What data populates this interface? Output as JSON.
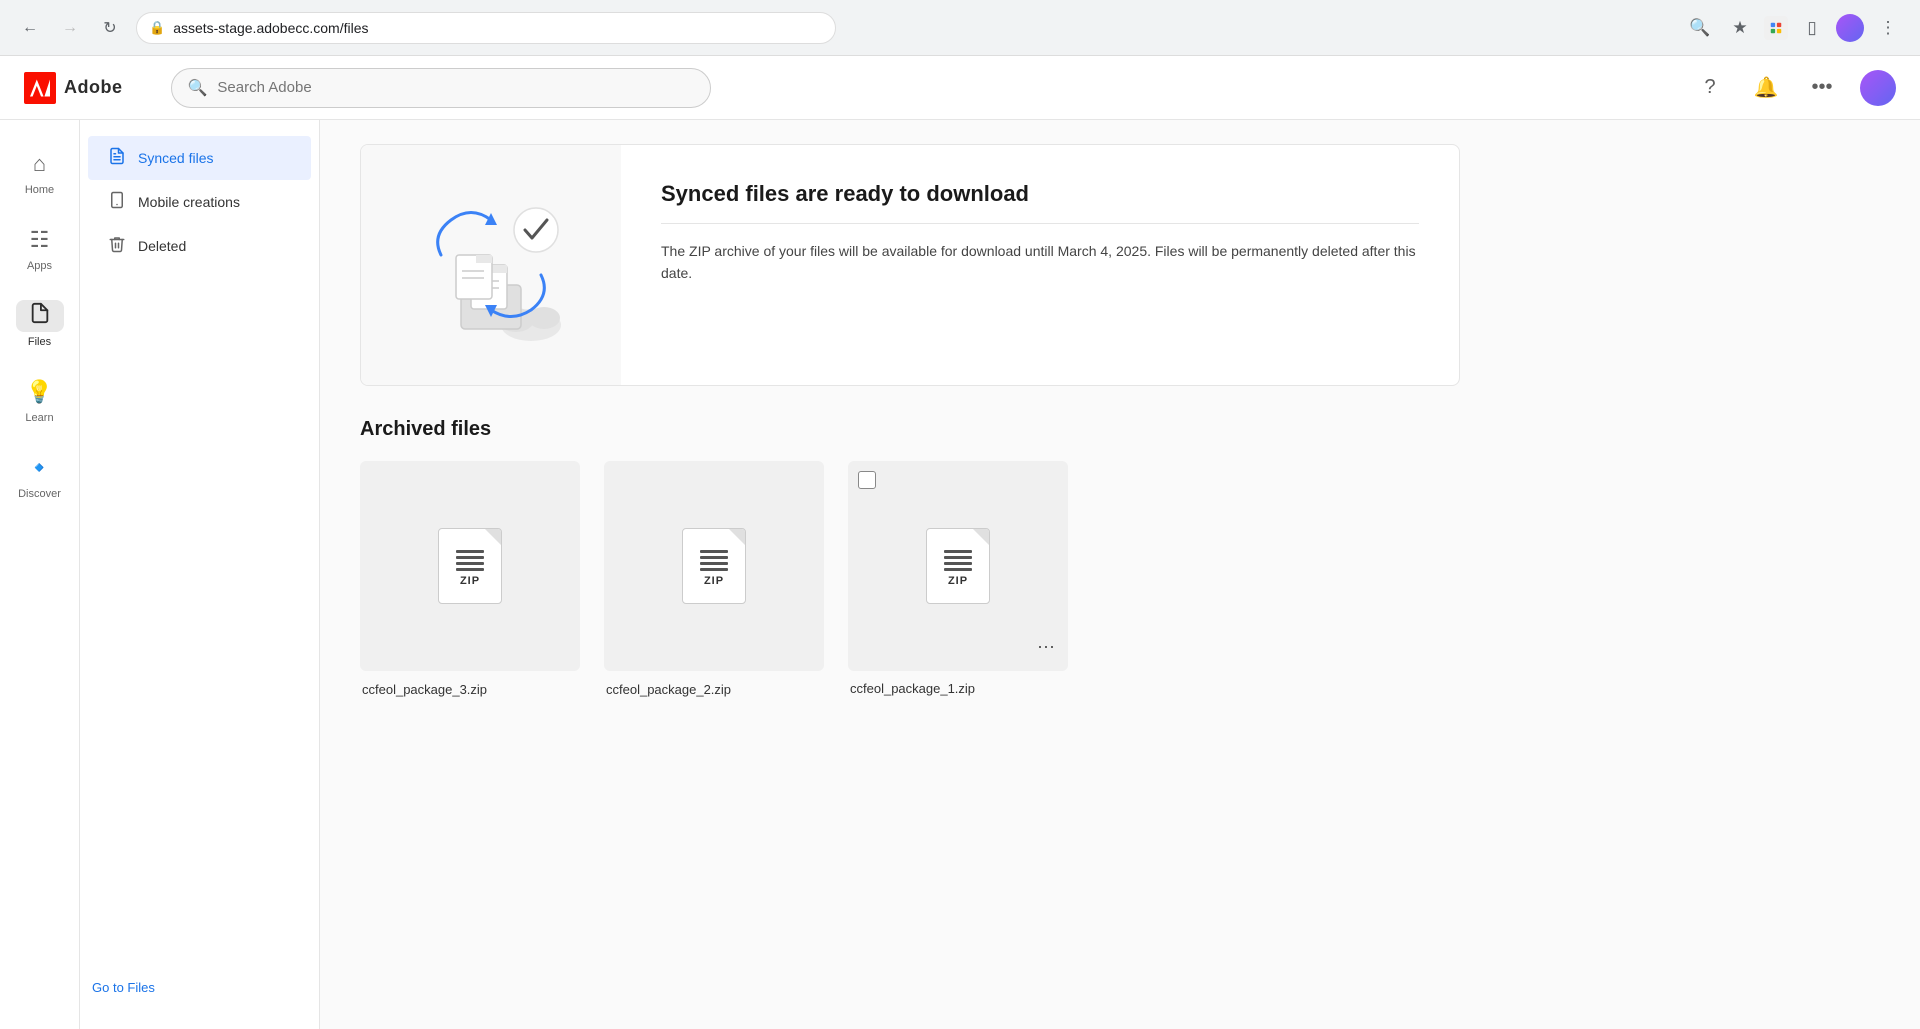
{
  "browser": {
    "url": "assets-stage.adobecc.com/files",
    "back_disabled": false,
    "forward_disabled": true
  },
  "header": {
    "logo_text": "Adobe",
    "search_placeholder": "Search Adobe"
  },
  "sidebar": {
    "items": [
      {
        "id": "home",
        "label": "Home",
        "icon": "home"
      },
      {
        "id": "apps",
        "label": "Apps",
        "icon": "apps"
      },
      {
        "id": "files",
        "label": "Files",
        "icon": "files",
        "active": true
      },
      {
        "id": "learn",
        "label": "Learn",
        "icon": "learn"
      },
      {
        "id": "discover",
        "label": "Discover",
        "icon": "discover"
      }
    ]
  },
  "secondary_sidebar": {
    "items": [
      {
        "id": "synced-files",
        "label": "Synced files",
        "icon": "file",
        "active": true
      },
      {
        "id": "mobile-creations",
        "label": "Mobile creations",
        "icon": "mobile"
      },
      {
        "id": "deleted",
        "label": "Deleted",
        "icon": "trash"
      }
    ],
    "bottom_link": "Go to Files"
  },
  "banner": {
    "title": "Synced files are ready to download",
    "description": "The ZIP archive of your files will be available for download untill March 4, 2025. Files will be permanently deleted after this date."
  },
  "archived_section": {
    "title": "Archived files",
    "files": [
      {
        "name": "ccfeol_package_3.zip",
        "show_checkbox": false,
        "show_menu": false
      },
      {
        "name": "ccfeol_package_2.zip",
        "show_checkbox": false,
        "show_menu": false
      },
      {
        "name": "ccfeol_package_1.zip",
        "show_checkbox": true,
        "show_menu": true
      }
    ]
  },
  "colors": {
    "adobe_red": "#fa0f00",
    "active_blue": "#1a73e8",
    "active_bg": "#eaf0ff"
  }
}
